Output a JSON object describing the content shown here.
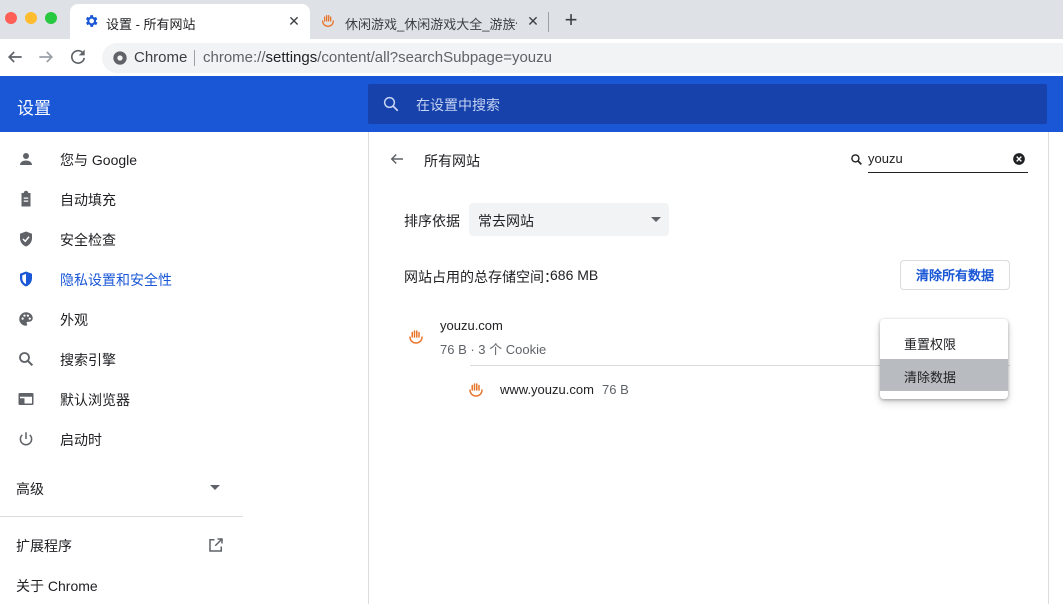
{
  "window": {
    "traffic_lights": [
      "#ff5f57",
      "#febc2e",
      "#28c840"
    ]
  },
  "tabs": [
    {
      "title": "设置 - 所有网站",
      "icon": "settings-gear-icon",
      "active": true
    },
    {
      "title": "休闲游戏_休闲游戏大全_游族休闲",
      "icon": "youzu-favicon",
      "active": false
    }
  ],
  "toolbar": {
    "omnibox_label": "Chrome",
    "url_scheme": "chrome://",
    "url_host": "settings",
    "url_path": "/content/all?searchSubpage=youzu"
  },
  "settings_header": {
    "title": "设置",
    "search_placeholder": "在设置中搜索"
  },
  "sidebar": {
    "items": [
      {
        "label": "您与 Google",
        "icon": "person-icon"
      },
      {
        "label": "自动填充",
        "icon": "clipboard-icon"
      },
      {
        "label": "安全检查",
        "icon": "shield-check-icon"
      },
      {
        "label": "隐私设置和安全性",
        "icon": "shield-privacy-icon",
        "selected": true
      },
      {
        "label": "外观",
        "icon": "palette-icon"
      },
      {
        "label": "搜索引擎",
        "icon": "search-icon"
      },
      {
        "label": "默认浏览器",
        "icon": "browser-window-icon"
      },
      {
        "label": "启动时",
        "icon": "power-icon"
      }
    ],
    "advanced_label": "高级",
    "extensions_label": "扩展程序",
    "about_label": "关于 Chrome"
  },
  "main": {
    "title": "所有网站",
    "site_search_value": "youzu",
    "sort_label": "排序依据",
    "sort_value": "常去网站",
    "storage_label": "网站占用的总存储空间：",
    "storage_value": "686 MB",
    "clear_all_label": "清除所有数据",
    "site": {
      "name": "youzu.com",
      "meta": "76 B · 3 个 Cookie",
      "sub": {
        "name": "www.youzu.com",
        "size": "76 B"
      }
    }
  },
  "context_menu": {
    "items": [
      "重置权限",
      "清除数据"
    ],
    "highlighted": 1
  },
  "colors": {
    "accent": "#1a57d6",
    "header_bg": "#1a57d6",
    "search_bg": "#1742ab"
  }
}
